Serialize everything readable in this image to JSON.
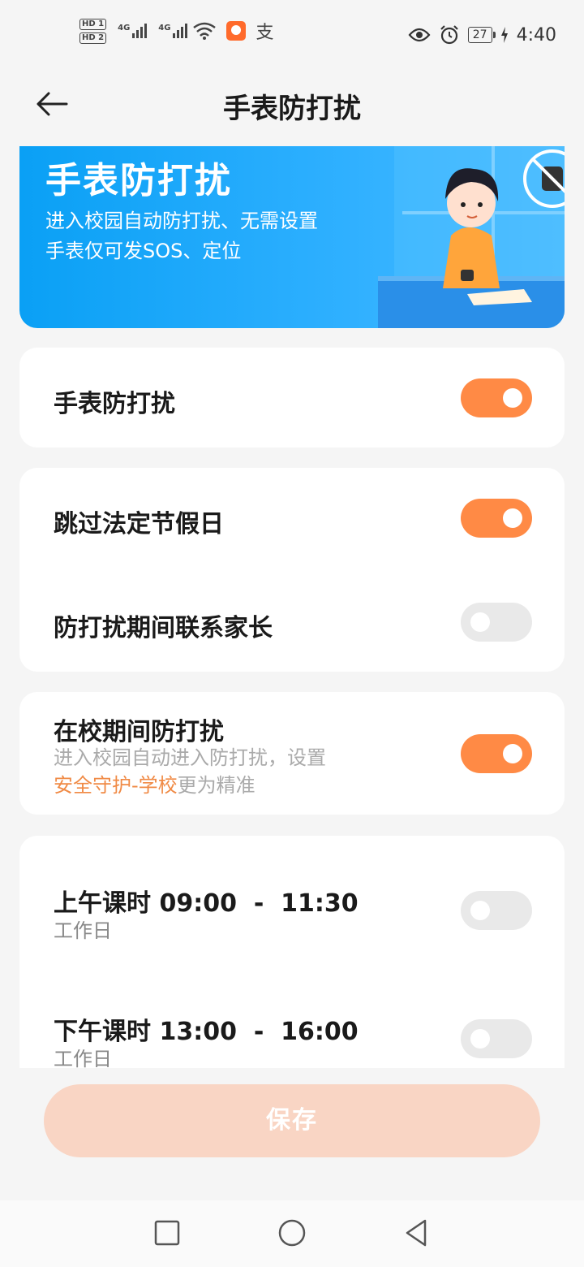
{
  "status_bar": {
    "hd1": "HD 1",
    "hd2": "HD 2",
    "net1": "4G",
    "net2": "4G",
    "pay_glyph": "支",
    "battery": "27",
    "time": "4:40",
    "icons": [
      "eye-icon",
      "alarm-icon",
      "charging-icon",
      "wifi-icon"
    ]
  },
  "header": {
    "title": "手表防打扰"
  },
  "banner": {
    "title": "手表防打扰",
    "line1": "进入校园自动防打扰、无需设置",
    "line2": "手表仅可发SOS、定位"
  },
  "settings": {
    "watch_dnd": {
      "label": "手表防打扰",
      "on": true
    },
    "skip_holidays": {
      "label": "跳过法定节假日",
      "on": true
    },
    "contact_parents": {
      "label": "防打扰期间联系家长",
      "on": false
    },
    "school_dnd": {
      "label": "在校期间防打扰",
      "sub_line1": "进入校园自动进入防打扰，设置",
      "sub_link": "安全守护-学校",
      "sub_tail": "更为精准",
      "on": true
    },
    "morning": {
      "label": "上午课时 09:00  -  11:30",
      "sub": "工作日",
      "on": false
    },
    "afternoon": {
      "label": "下午课时 13:00  -  16:00",
      "sub": "工作日",
      "on": false
    }
  },
  "save_label": "保存",
  "colors": {
    "accent": "#ff8a45",
    "banner": "#0aa0f5",
    "save_disabled": "#f9d5c4"
  }
}
